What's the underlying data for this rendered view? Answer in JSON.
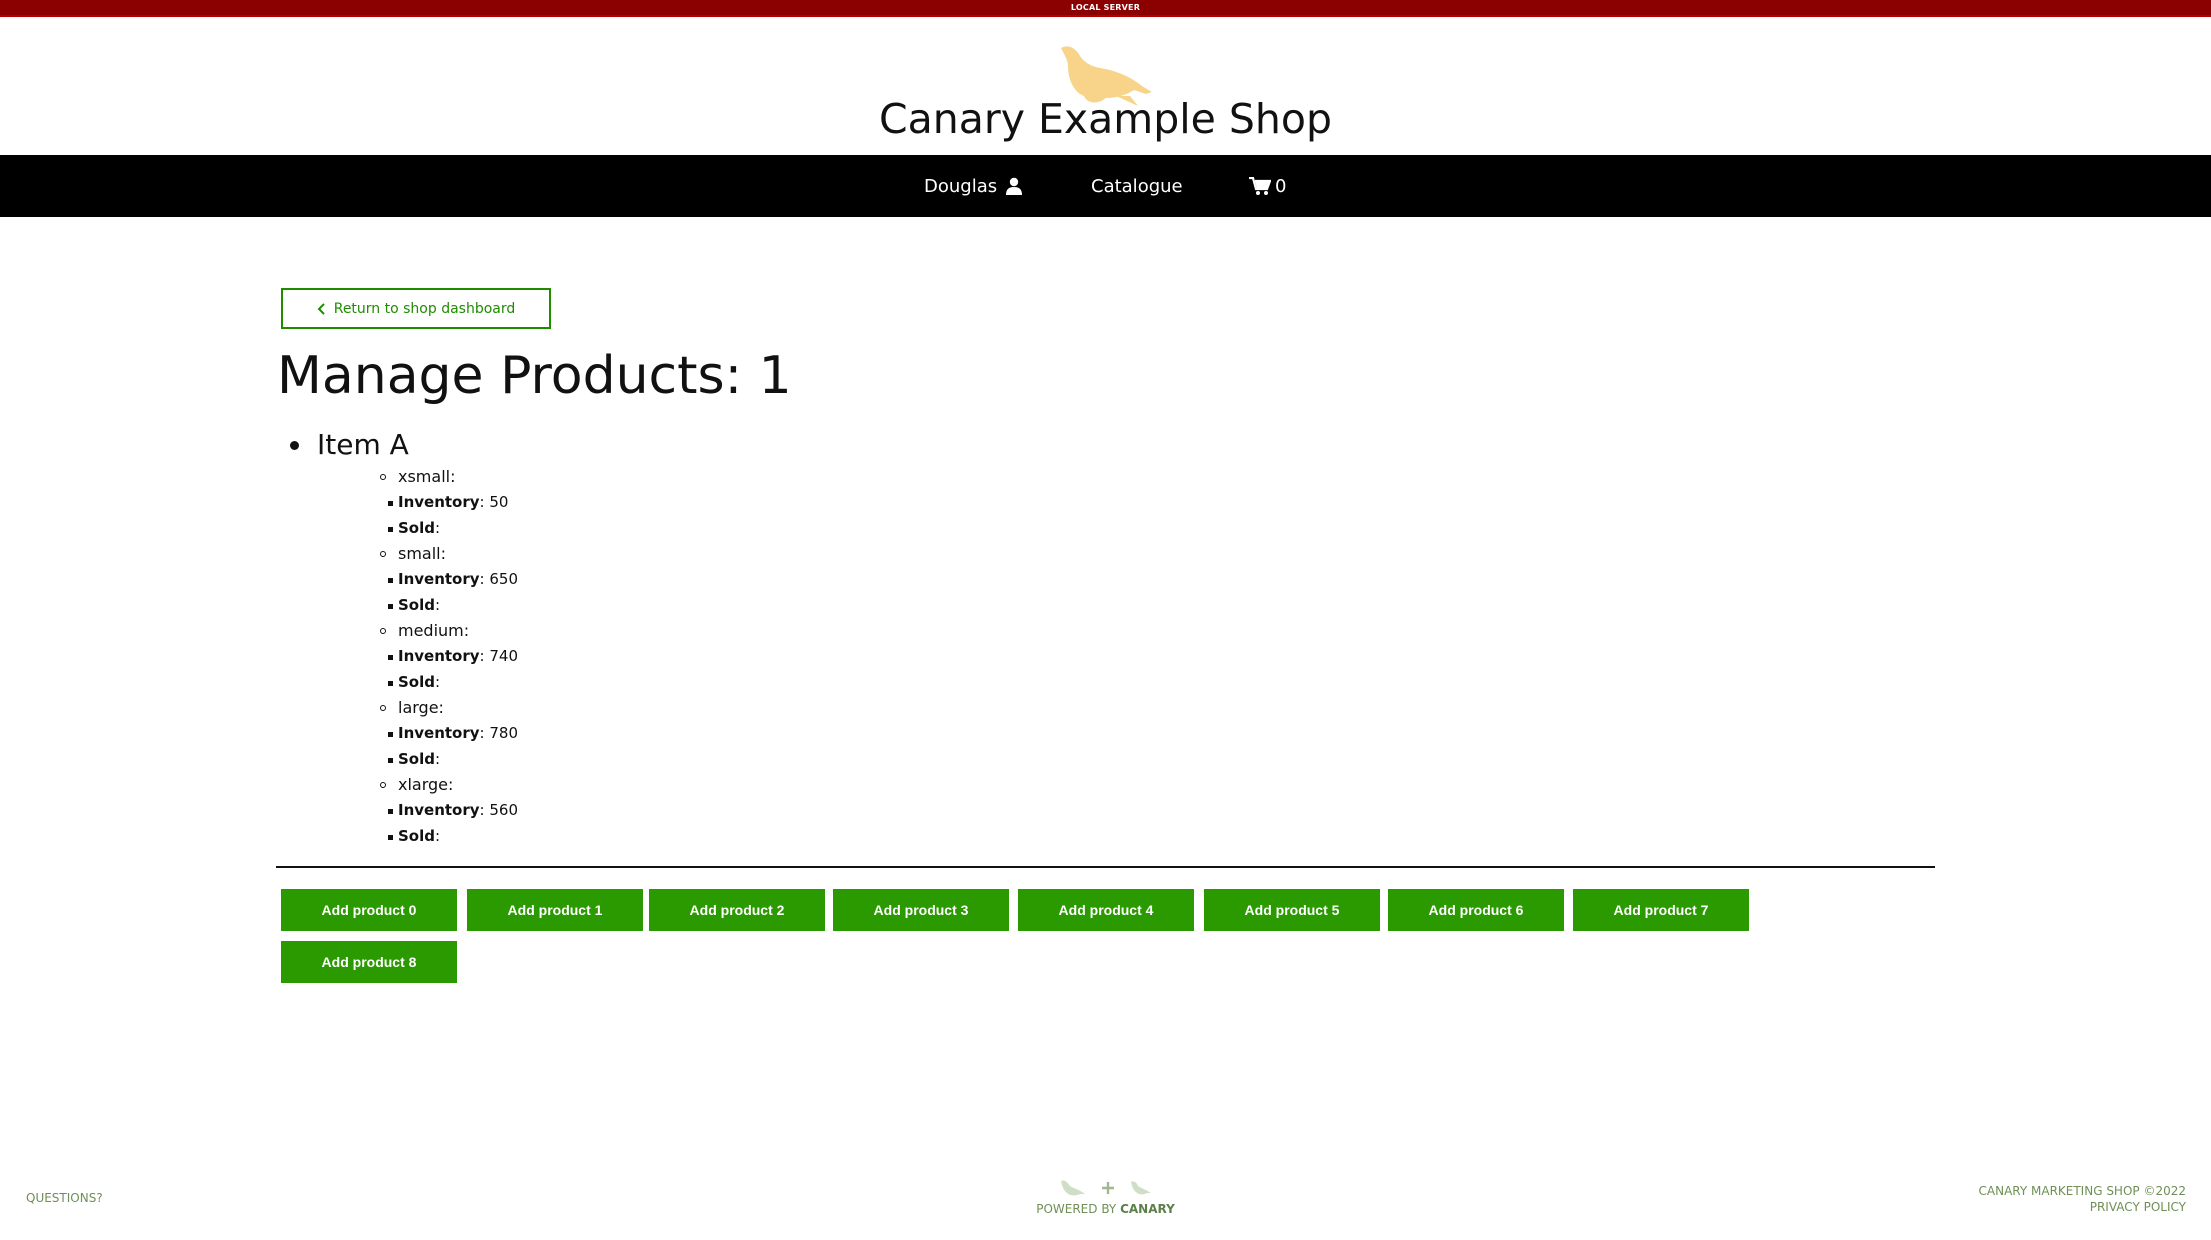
{
  "topbar": {
    "label": "LOCAL SERVER"
  },
  "header": {
    "logo_icon": "canary-bird-icon",
    "title": "Canary Example Shop",
    "bird_color": "#f7d48a"
  },
  "nav": {
    "user_label": "Douglas",
    "user_icon": "user-icon",
    "catalogue_label": "Catalogue",
    "cart_icon": "cart-icon",
    "cart_count": "0"
  },
  "main": {
    "return_label": "Return to shop dashboard",
    "title": "Manage Products: 1",
    "products": [
      {
        "name": "Item A",
        "sizes": [
          {
            "name": "xsmall:",
            "inventory_label": "Inventory",
            "inventory_value": ": 50",
            "sold_label": "Sold",
            "sold_value": ":"
          },
          {
            "name": "small:",
            "inventory_label": "Inventory",
            "inventory_value": ": 650",
            "sold_label": "Sold",
            "sold_value": ":"
          },
          {
            "name": "medium:",
            "inventory_label": "Inventory",
            "inventory_value": ": 740",
            "sold_label": "Sold",
            "sold_value": ":"
          },
          {
            "name": "large:",
            "inventory_label": "Inventory",
            "inventory_value": ": 780",
            "sold_label": "Sold",
            "sold_value": ":"
          },
          {
            "name": "xlarge:",
            "inventory_label": "Inventory",
            "inventory_value": ": 560",
            "sold_label": "Sold",
            "sold_value": ":"
          }
        ]
      }
    ],
    "add_buttons": [
      "Add product 0",
      "Add product 1",
      "Add product 2",
      "Add product 3",
      "Add product 4",
      "Add product 5",
      "Add product 6",
      "Add product 7",
      "Add product 8"
    ]
  },
  "footer": {
    "questions": "QUESTIONS?",
    "powered_prefix": "POWERED BY",
    "powered_brand": "CANARY",
    "copyright": "CANARY MARKETING SHOP ©2022",
    "privacy": "PRIVACY POLICY"
  },
  "colors": {
    "topbar": "#8b0000",
    "nav": "#000000",
    "accent_green": "#2a9a00",
    "footer_text": "#6f8f56"
  }
}
